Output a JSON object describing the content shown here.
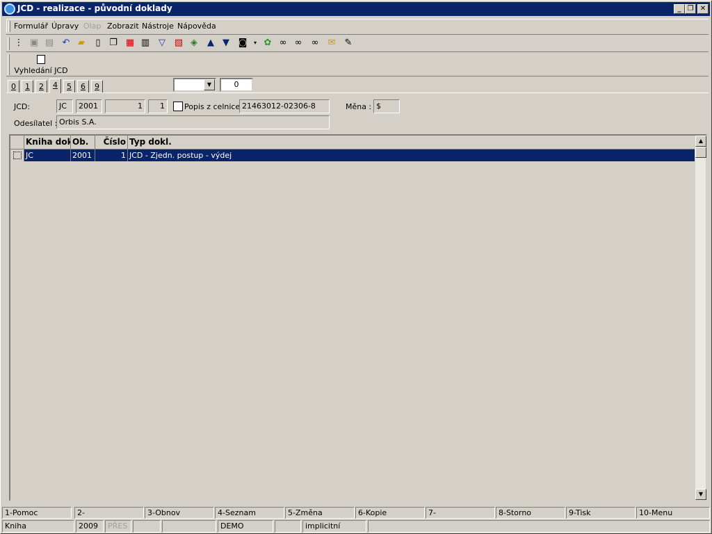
{
  "window": {
    "title": "JCD - realizace - původní doklady",
    "minimize_label": "_",
    "restore_label": "❐",
    "close_label": "✕"
  },
  "menubar": {
    "items": [
      {
        "label": "Formulář",
        "enabled": true
      },
      {
        "label": "Úpravy",
        "enabled": true
      },
      {
        "label": "Olap",
        "enabled": false
      },
      {
        "label": "Zobrazit",
        "enabled": true
      },
      {
        "label": "Nástroje",
        "enabled": true
      },
      {
        "label": "Nápověda",
        "enabled": true
      }
    ]
  },
  "toolbar": {
    "icons": [
      "tree-icon",
      "save-icon",
      "save-as-icon",
      "undo-icon",
      "open-folder-icon",
      "new-document-icon",
      "copy-icon",
      "paste-icon",
      "book-icon",
      "filter-icon",
      "filter-document-icon",
      "stack-icon",
      "arrow-up-icon",
      "arrow-down-icon",
      "camera-icon",
      "dropdown-arrow-icon",
      "plant-icon",
      "binoculars-icon",
      "binoculars-next-icon",
      "binoculars-all-icon",
      "mail-icon",
      "notepad-icon"
    ]
  },
  "toolbar2": {
    "search_label": "Vyhledání JCD"
  },
  "tabs": {
    "items": [
      "0",
      "1",
      "2",
      "4",
      "5",
      "6",
      "9"
    ],
    "active": "4"
  },
  "filter": {
    "combo_value": "",
    "number_value": "0"
  },
  "header": {
    "jcd_label": "JCD:",
    "jcd_book": "JC",
    "jcd_year": "2001",
    "jcd_number": "1",
    "jcd_line": "1",
    "customs_label": "Popis z celnice:",
    "customs_value": "21463012-02306-8",
    "currency_label": "Měna :",
    "currency_value": "$",
    "sender_label": "Odesílatel :",
    "sender_value": "Orbis S.A."
  },
  "grid": {
    "columns": [
      "Kniha dok",
      "Ob.",
      "Číslo",
      "Typ dokl."
    ],
    "rows": [
      {
        "kniha": "JC",
        "ob": "2001",
        "cislo": "1",
        "typ": "JCD - Zjedn. postup - výdej",
        "selected": true
      }
    ]
  },
  "fkeys": [
    "1-Pomoc",
    "2-",
    "3-Obnov",
    "4-Seznam",
    "5-Změna",
    "6-Kopie",
    "7-",
    "8-Storno",
    "9-Tisk",
    "10-Menu"
  ],
  "statusbar": {
    "module": "Kniha",
    "year": "2009",
    "mode": "PŘES",
    "empty1": "",
    "empty2": "",
    "database": "DEMO",
    "empty3": "",
    "profile": "implicitní"
  },
  "colors": {
    "titlebar": "#0a246a",
    "face": "#d4d0c8",
    "selection": "#0a246a"
  }
}
